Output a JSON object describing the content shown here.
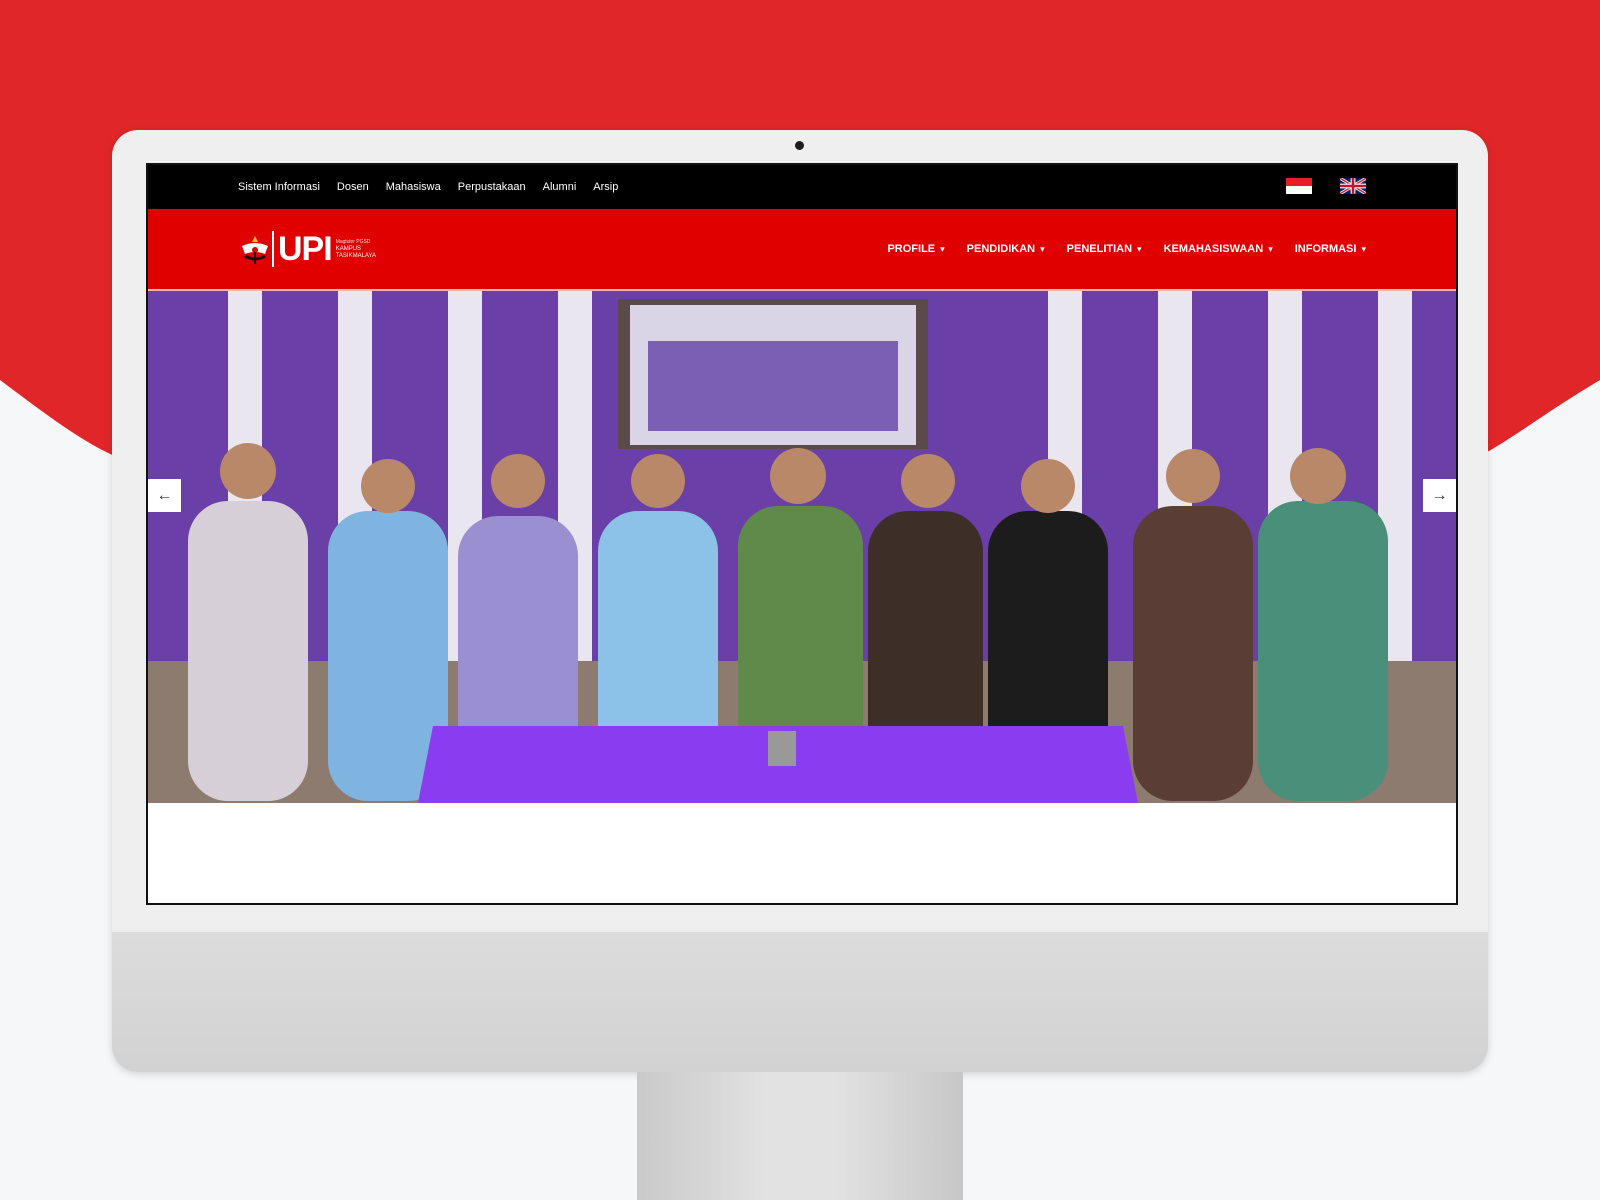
{
  "topbar": {
    "links": [
      "Sistem Informasi",
      "Dosen",
      "Mahasiswa",
      "Perpustakaan",
      "Alumni",
      "Arsip"
    ]
  },
  "logo": {
    "mark": "UPI",
    "subtitle_small": "Magister PGSD",
    "subtitle_line1": "KAMPUS",
    "subtitle_line2": "TASIKMALAYA"
  },
  "nav": {
    "items": [
      "PROFILE",
      "PENDIDIKAN",
      "PENELITIAN",
      "KEMAHASISWAAN",
      "INFORMASI"
    ]
  },
  "hero": {
    "icons": {
      "prev": "arrow-left-icon",
      "next": "arrow-right-icon"
    },
    "colors": {
      "wall_purple": "#6a3fa8",
      "tablecloth": "#8a3df0"
    }
  },
  "colors": {
    "brand_red": "#e00000",
    "backdrop_red": "#e02628",
    "topbar": "#000000"
  }
}
